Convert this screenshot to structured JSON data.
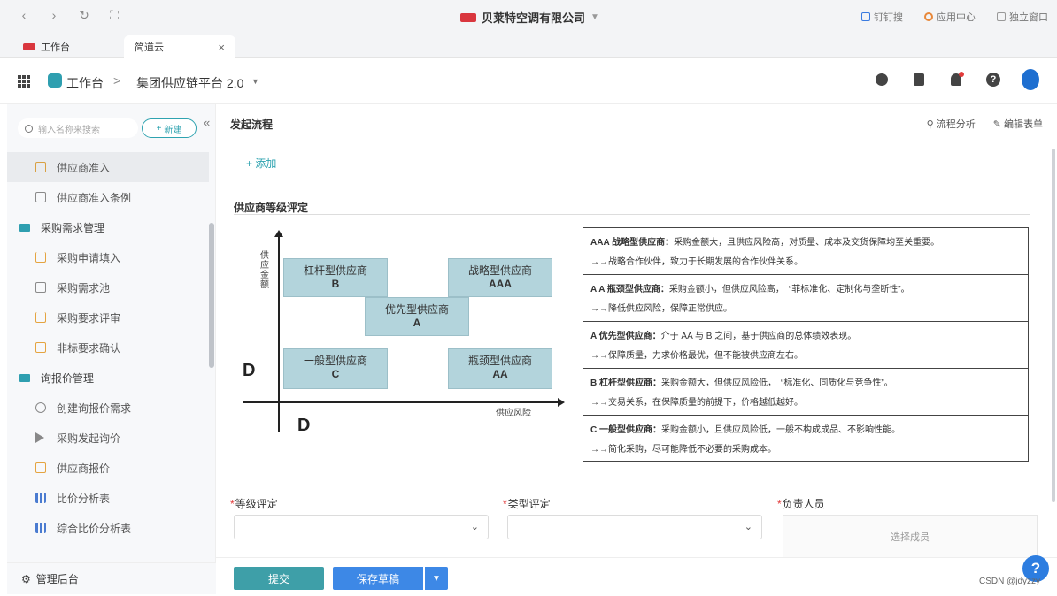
{
  "browser": {
    "company": "贝莱特空调有限公司",
    "right_items": [
      "钉钉搜",
      "应用中心",
      "独立窗口"
    ]
  },
  "tabs": [
    {
      "label": "工作台"
    },
    {
      "label": "简道云"
    }
  ],
  "header": {
    "workspace": "工作台",
    "separator": ">",
    "platform": "集团供应链平台 2.0"
  },
  "sidebar": {
    "search_placeholder": "输入名称来搜索",
    "new_label": "新建",
    "items": [
      {
        "label": "供应商准入",
        "type": "sub",
        "icon": "home-icon"
      },
      {
        "label": "供应商准入条例",
        "type": "sub",
        "icon": "document-icon"
      },
      {
        "label": "采购需求管理",
        "type": "group",
        "icon": "folder-icon"
      },
      {
        "label": "采购申请填入",
        "type": "sub",
        "icon": "cart-icon"
      },
      {
        "label": "采购需求池",
        "type": "sub",
        "icon": "document-icon"
      },
      {
        "label": "采购要求评审",
        "type": "sub",
        "icon": "cart-icon"
      },
      {
        "label": "非标要求确认",
        "type": "sub",
        "icon": "badge-icon"
      },
      {
        "label": "询报价管理",
        "type": "group",
        "icon": "folder-icon"
      },
      {
        "label": "创建询报价需求",
        "type": "sub",
        "icon": "tag-icon"
      },
      {
        "label": "采购发起询价",
        "type": "sub",
        "icon": "play-icon"
      },
      {
        "label": "供应商报价",
        "type": "sub",
        "icon": "badge-icon"
      },
      {
        "label": "比价分析表",
        "type": "sub",
        "icon": "bar-chart-icon"
      },
      {
        "label": "综合比价分析表",
        "type": "sub",
        "icon": "bar-chart-icon"
      }
    ],
    "admin_label": "管理后台"
  },
  "main": {
    "title": "发起流程",
    "actions": [
      "流程分析",
      "编辑表单"
    ],
    "add_label": "+ 添加",
    "section_title": "供应商等级评定"
  },
  "matrix": {
    "ylabel": "供应金额",
    "xlabel": "供应风险",
    "corner_labels": [
      "D",
      "D"
    ],
    "cells": [
      {
        "name": "杠杆型供应商",
        "grade": "B"
      },
      {
        "name": "战略型供应商",
        "grade": "AAA"
      },
      {
        "name": "优先型供应商",
        "grade": "A"
      },
      {
        "name": "一般型供应商",
        "grade": "C"
      },
      {
        "name": "瓶颈型供应商",
        "grade": "AA"
      }
    ]
  },
  "descriptions": [
    {
      "title": "AAA 战略型供应商：",
      "line1": "采购金额大，且供应风险高，对质量、成本及交货保障均至关重要。",
      "line2": "→→战略合作伙伴，致力于长期发展的合作伙伴关系。"
    },
    {
      "title": "A A 瓶颈型供应商：",
      "line1": "采购金额小，但供应风险高，　“菲标准化、定制化与垄断性”。",
      "line2": "→→降低供应风险，保障正常供应。"
    },
    {
      "title": "A 优先型供应商：",
      "line1": "介于 AA 与 B 之间，基于供应商的总体绩效表现。",
      "line2": "→→保障质量，力求价格最优，但不能被供应商左右。"
    },
    {
      "title": "B 杠杆型供应商：",
      "line1": "采购金额大，但供应风险低，　“标准化、同质化与竞争性”。",
      "line2": "→→交易关系，在保障质量的前提下，价格越低越好。"
    },
    {
      "title": "C 一般型供应商：",
      "line1": "采购金额小，且供应风险低，一般不构成成品、不影响性能。",
      "line2": "→→简化采购，尽可能降低不必要的采购成本。"
    }
  ],
  "form": {
    "grade_label": "等级评定",
    "type_label": "类型评定",
    "owner_label": "负责人员",
    "member_placeholder": "选择成员"
  },
  "footer": {
    "submit_label": "提交",
    "draft_label": "保存草稿",
    "help_label": "?",
    "watermark": "CSDN @jdyzzy"
  }
}
